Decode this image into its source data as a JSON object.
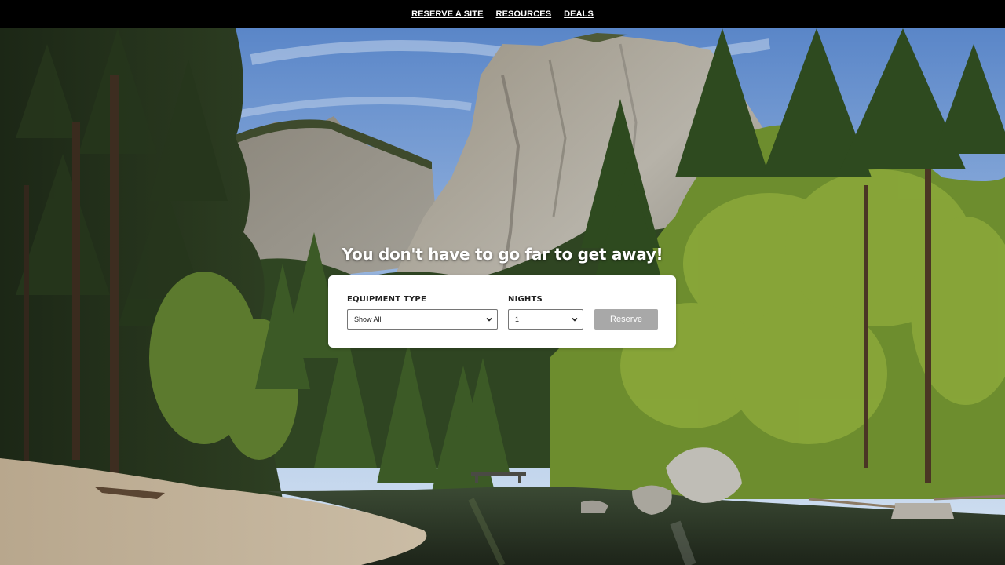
{
  "nav": {
    "items": [
      {
        "label": "RESERVE A SITE"
      },
      {
        "label": "RESOURCES"
      },
      {
        "label": "DEALS"
      }
    ]
  },
  "hero": {
    "headline": "You don't have to go far to get away!"
  },
  "form": {
    "equipment": {
      "label": "EQUIPMENT TYPE",
      "selected": "Show All"
    },
    "nights": {
      "label": "NIGHTS",
      "selected": "1"
    },
    "reserve_label": "Reserve"
  },
  "colors": {
    "nav_bg": "#000000",
    "button_bg": "#a8a8a8",
    "card_bg": "#ffffff"
  }
}
